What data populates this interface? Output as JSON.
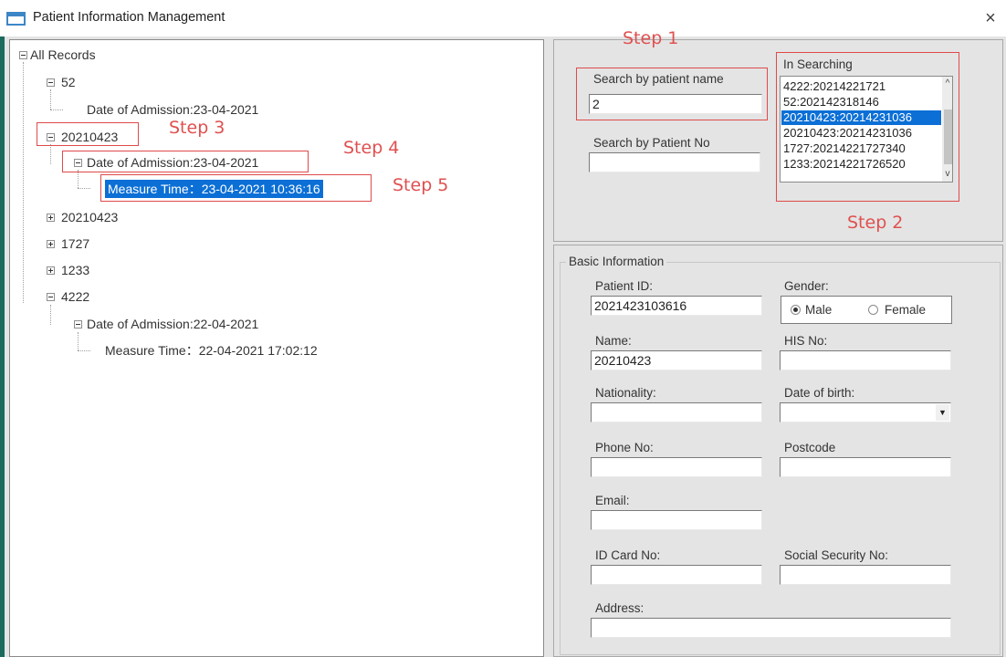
{
  "window": {
    "title": "Patient Information Management",
    "close_glyph": "×"
  },
  "tree": {
    "root_label": "All Records",
    "nodes": [
      {
        "label": "52",
        "expanded": true
      },
      {
        "label": "Date of Admission:23-04-2021"
      },
      {
        "label": "20210423",
        "expanded": true
      },
      {
        "label": "Date of Admission:23-04-2021",
        "expanded": true
      },
      {
        "label": "Measure Time：23-04-2021 10:36:16",
        "selected": true
      },
      {
        "label": "20210423",
        "expanded": false
      },
      {
        "label": "1727",
        "expanded": false
      },
      {
        "label": "1233",
        "expanded": false
      },
      {
        "label": "4222",
        "expanded": true
      },
      {
        "label": "Date of Admission:22-04-2021",
        "expanded": true
      },
      {
        "label": "Measure Time：22-04-2021 17:02:12"
      }
    ]
  },
  "annotations": {
    "step1": "Step 1",
    "step2": "Step 2",
    "step3": "Step 3",
    "step4": "Step 4",
    "step5": "Step 5",
    "color": "#e04a4a"
  },
  "search": {
    "by_name_label": "Search by patient name",
    "by_name_value": "2",
    "by_no_label": "Search by Patient  No",
    "by_no_value": "",
    "results_label": "In Searching",
    "results": [
      "4222:20214221721",
      "52:202142318146",
      "20210423:20214231036",
      "20210423:20214231036",
      "1727:20214221727340",
      "1233:20214221726520"
    ],
    "selected_index": 2
  },
  "basic_info": {
    "group_title": "Basic Information",
    "patient_id_label": "Patient ID:",
    "patient_id_value": "2021423103616",
    "gender_label": "Gender:",
    "gender_male": "Male",
    "gender_female": "Female",
    "gender_selected": "Male",
    "name_label": "Name:",
    "name_value": "20210423",
    "his_label": "HIS No:",
    "his_value": "",
    "nationality_label": "Nationality:",
    "nationality_value": "",
    "dob_label": "Date of birth:",
    "dob_value": "",
    "phone_label": "Phone No:",
    "phone_value": "",
    "postcode_label": "Postcode",
    "postcode_value": "",
    "email_label": "Email:",
    "email_value": "",
    "id_card_label": "ID Card No:",
    "id_card_value": "",
    "social_label": "Social Security No:",
    "social_value": "",
    "address_label": "Address:",
    "address_value": ""
  },
  "colors": {
    "selection": "#0b6fd6",
    "frame_accent": "#1a6b5c",
    "panel_bg": "#e4e4e4",
    "annotation_red": "#e04a4a"
  }
}
